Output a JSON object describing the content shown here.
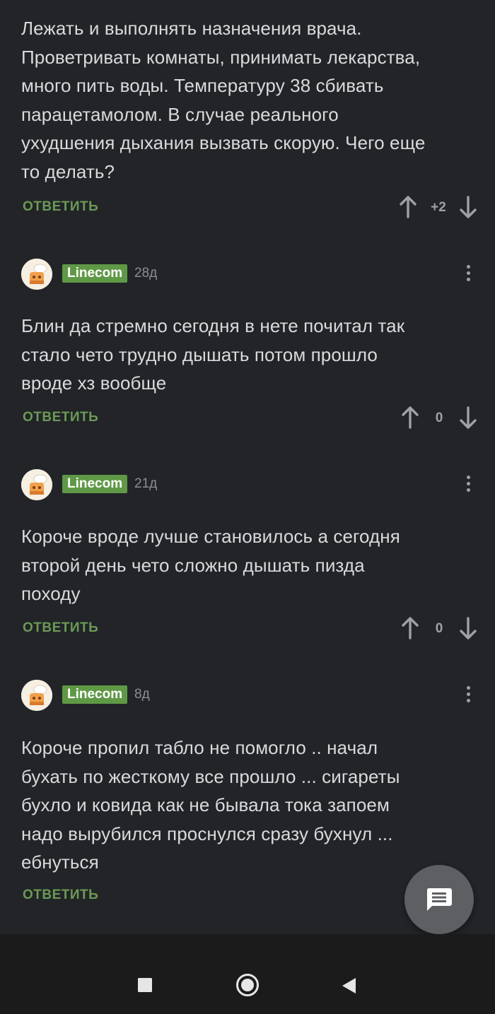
{
  "first_comment": {
    "body_lines": [
      "Лежать и выполнять назначения врача.",
      "Проветривать комнаты, принимать лекарства,",
      "много пить воды. Температуру 38 сбивать",
      "парацетамолом. В случае реального",
      "ухудшения дыхания вызвать скорую.  Чего еще",
      "то делать?"
    ],
    "reply_label": "ОТВЕТИТЬ",
    "rating": "+2"
  },
  "comments": [
    {
      "author": "Linecom",
      "age": "28д",
      "body_lines": [
        "Блин да стремно сегодня в нете почитал так",
        "стало чето трудно дышать потом прошло",
        "вроде хз вообще"
      ],
      "reply_label": "ОТВЕТИТЬ",
      "rating": "0"
    },
    {
      "author": "Linecom",
      "age": "21д",
      "body_lines": [
        "Короче вроде лучше становилось а сегодня",
        "второй день чето сложно дышать пизда",
        "походу"
      ],
      "reply_label": "ОТВЕТИТЬ",
      "rating": "0"
    },
    {
      "author": "Linecom",
      "age": "8д",
      "body_lines": [
        "Короче пропил табло не помогло .. начал",
        "бухать по жесткому все прошло ... сигареты",
        "бухло и ковида как не бывала тока запоем",
        "надо вырубился проснулся сразу бухнул ...",
        "ебнуться"
      ],
      "reply_label": "ОТВЕТИТЬ"
    }
  ],
  "icons": {
    "vote_up": "arrow-up-icon",
    "vote_down": "arrow-down-icon",
    "menu": "more-vertical-icon",
    "fab": "comment-icon",
    "nav_recents": "square-icon",
    "nav_home": "circle-icon",
    "nav_back": "triangle-back-icon"
  },
  "colors": {
    "background": "#222428",
    "text": "#d9dadc",
    "accent_green": "#5f9946",
    "reply_green": "#6c9a55",
    "muted": "#8a8e94"
  }
}
